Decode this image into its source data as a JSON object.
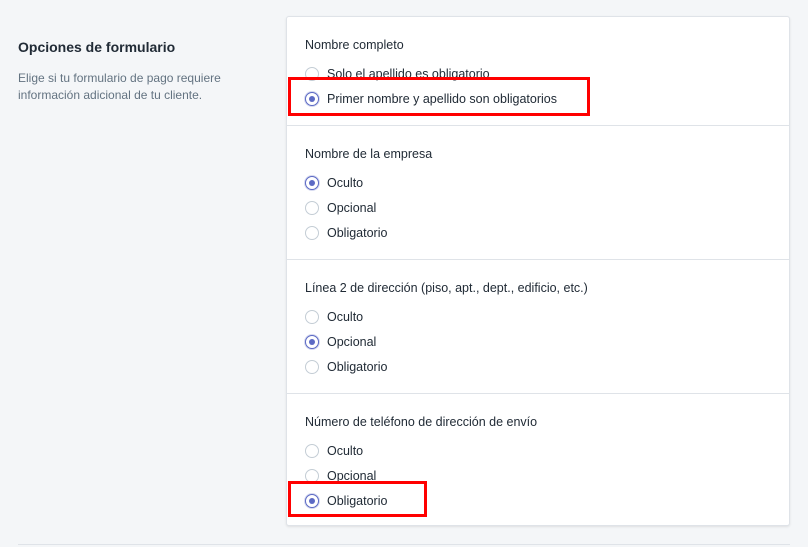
{
  "left": {
    "title": "Opciones de formulario",
    "description": "Elige si tu formulario de pago requiere información adicional de tu cliente."
  },
  "sections": [
    {
      "title": "Nombre completo",
      "options": [
        {
          "label": "Solo el apellido es obligatorio",
          "checked": false
        },
        {
          "label": "Primer nombre y apellido son obligatorios",
          "checked": true
        }
      ]
    },
    {
      "title": "Nombre de la empresa",
      "options": [
        {
          "label": "Oculto",
          "checked": true
        },
        {
          "label": "Opcional",
          "checked": false
        },
        {
          "label": "Obligatorio",
          "checked": false
        }
      ]
    },
    {
      "title": "Línea 2 de dirección (piso, apt., dept., edificio, etc.)",
      "options": [
        {
          "label": "Oculto",
          "checked": false
        },
        {
          "label": "Opcional",
          "checked": true
        },
        {
          "label": "Obligatorio",
          "checked": false
        }
      ]
    },
    {
      "title": "Número de teléfono de dirección de envío",
      "options": [
        {
          "label": "Oculto",
          "checked": false
        },
        {
          "label": "Opcional",
          "checked": false
        },
        {
          "label": "Obligatorio",
          "checked": true
        }
      ]
    }
  ],
  "colors": {
    "accent": "#5c6ac4",
    "highlight": "#ff0000"
  }
}
